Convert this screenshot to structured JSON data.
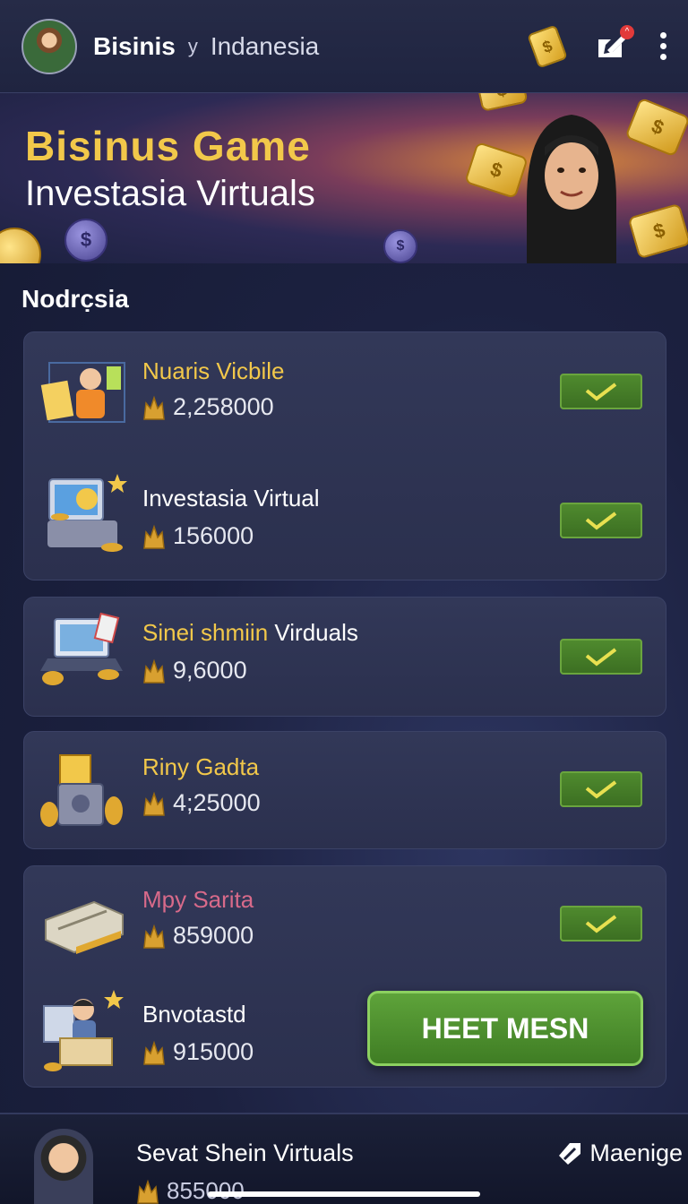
{
  "header": {
    "brand": "Bisinis",
    "separator": "y",
    "region": "Indanesia",
    "notif_badge": "^"
  },
  "banner": {
    "title": "Bisinus Game",
    "subtitle": "Investasia Virtuals"
  },
  "section_label": "Nodrc̣sia",
  "items": [
    {
      "title": "Nuaris Vicbile",
      "amount": "258000",
      "amount_prefix": "2,",
      "title_color": "gold"
    },
    {
      "title": "Investasia Virtual",
      "amount": "156000",
      "title_color": "white"
    },
    {
      "title_part1": "Sinei shmiin",
      "title_part2": "Virduals",
      "amount": "9,6000"
    },
    {
      "title": "Riny Gadta",
      "amount": "4;25000",
      "title_color": "gold"
    },
    {
      "title": "Mpy Sarita",
      "amount": "859000",
      "title_color": "pink"
    },
    {
      "title": "Bnvotastd",
      "amount": "915000",
      "title_color": "white"
    }
  ],
  "cta_button": "HEET MESN",
  "bottom": {
    "title": "Sevat Shein Virtuals",
    "amount": "855000",
    "manage": "Maenige"
  },
  "colors": {
    "accent_gold": "#f2c84a",
    "check_green": "#4f8a2e",
    "background": "#1c2140"
  }
}
